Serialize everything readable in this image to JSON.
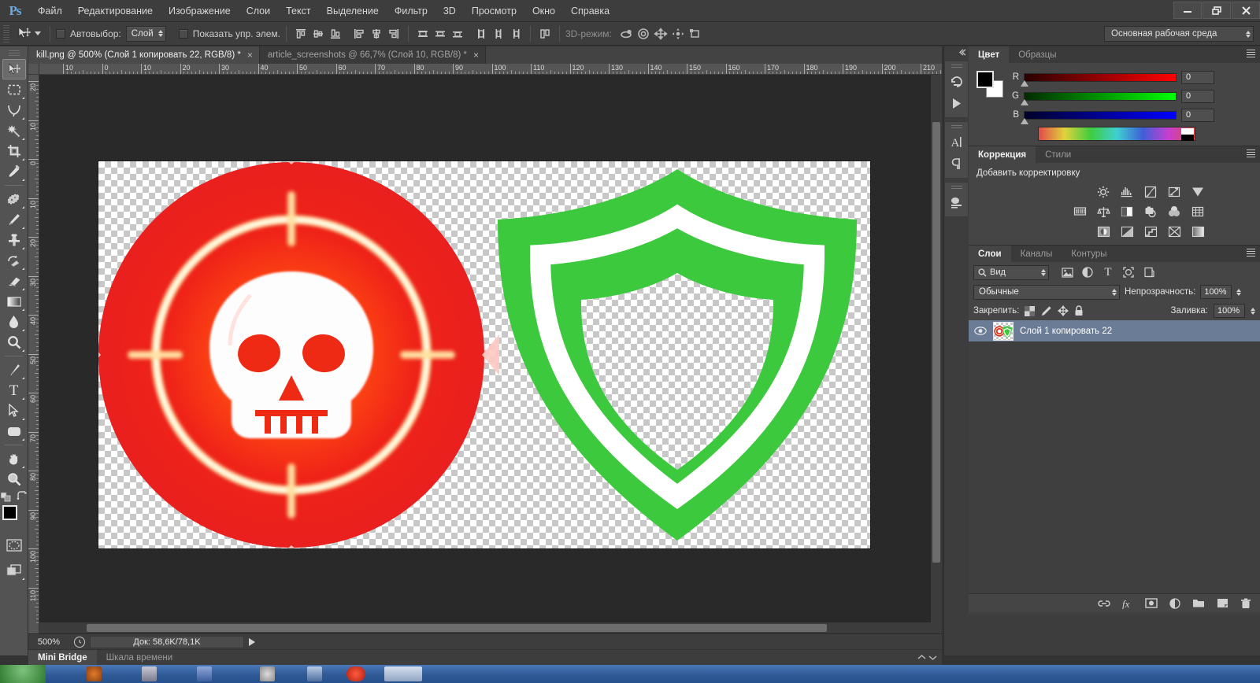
{
  "app": {
    "logo": "Ps",
    "menu": [
      "Файл",
      "Редактирование",
      "Изображение",
      "Слои",
      "Текст",
      "Выделение",
      "Фильтр",
      "3D",
      "Просмотр",
      "Окно",
      "Справка"
    ],
    "window_controls": {
      "minimize": "minimize-icon",
      "restore": "restore-icon",
      "close": "close-icon"
    }
  },
  "options_bar": {
    "tool_icon": "move-tool-icon",
    "autoselect_label": "Автовыбор:",
    "autoselect_checked": false,
    "autoselect_scope": "Слой",
    "show_controls_label": "Показать упр. элем.",
    "show_controls_checked": false,
    "align_icons": [
      "align-top-edges-icon",
      "align-vertical-centers-icon",
      "align-bottom-edges-icon",
      "align-left-edges-icon",
      "align-horizontal-centers-icon",
      "align-right-edges-icon"
    ],
    "distribute_icons": [
      "distribute-top-edges-icon",
      "distribute-vertical-centers-icon",
      "distribute-bottom-edges-icon",
      "distribute-left-edges-icon",
      "distribute-horizontal-centers-icon",
      "distribute-right-edges-icon"
    ],
    "auto_align_icon": "auto-align-layers-icon",
    "mode3d_label": "3D-режим:",
    "mode3d_icons": [
      "rotate-3d-object-icon",
      "roll-3d-object-icon",
      "drag-3d-object-icon",
      "slide-3d-object-icon",
      "scale-3d-object-icon"
    ],
    "workspace": "Основная рабочая среда"
  },
  "tabs": [
    {
      "title": "kill.png @ 500% (Слой 1 копировать 22, RGB/8) *",
      "active": true,
      "close": "×"
    },
    {
      "title": "article_screenshots @ 66,7% (Слой 10, RGB/8) *",
      "active": false,
      "close": "×"
    }
  ],
  "toolbar": {
    "tools": [
      {
        "name": "move-tool",
        "selected": true,
        "submenu": false
      },
      {
        "name": "rectangular-marquee-tool",
        "selected": false,
        "submenu": true
      },
      {
        "name": "lasso-tool",
        "selected": false,
        "submenu": true
      },
      {
        "name": "magic-wand-tool",
        "selected": false,
        "submenu": true
      },
      {
        "name": "crop-tool",
        "selected": false,
        "submenu": true
      },
      {
        "name": "eyedropper-tool",
        "selected": false,
        "submenu": true
      },
      {
        "name": "spot-healing-brush-tool",
        "selected": false,
        "submenu": true
      },
      {
        "name": "brush-tool",
        "selected": false,
        "submenu": true
      },
      {
        "name": "clone-stamp-tool",
        "selected": false,
        "submenu": true
      },
      {
        "name": "history-brush-tool",
        "selected": false,
        "submenu": true
      },
      {
        "name": "eraser-tool",
        "selected": false,
        "submenu": true
      },
      {
        "name": "gradient-tool",
        "selected": false,
        "submenu": true
      },
      {
        "name": "blur-tool",
        "selected": false,
        "submenu": true
      },
      {
        "name": "dodge-tool",
        "selected": false,
        "submenu": true
      },
      {
        "name": "pen-tool",
        "selected": false,
        "submenu": true
      },
      {
        "name": "horizontal-type-tool",
        "selected": false,
        "submenu": true
      },
      {
        "name": "path-selection-tool",
        "selected": false,
        "submenu": true
      },
      {
        "name": "rounded-rectangle-tool",
        "selected": false,
        "submenu": true
      },
      {
        "name": "hand-tool",
        "selected": false,
        "submenu": true
      },
      {
        "name": "zoom-tool",
        "selected": false,
        "submenu": true
      }
    ],
    "swap_colors_icon": "swap-foreground-background-icon",
    "default_colors_icon": "default-colors-icon",
    "foreground_color": "#000000",
    "background_color": "#ffffff",
    "quick_mask_icon": "quick-mask-mode-icon",
    "screen_mode_icon": "screen-mode-icon"
  },
  "rulers": {
    "unit_hint": "mm",
    "horizontal_labels": [
      "10",
      "0",
      "10",
      "20",
      "30",
      "40",
      "50",
      "60",
      "70",
      "80",
      "90",
      "100",
      "110",
      "120",
      "130",
      "140",
      "150",
      "160",
      "170",
      "180",
      "190",
      "200",
      "210"
    ],
    "vertical_labels": [
      "20",
      "10",
      "0",
      "10",
      "20",
      "30",
      "40",
      "50",
      "60",
      "70",
      "80",
      "90",
      "100",
      "110"
    ]
  },
  "canvas": {
    "document": "kill.png",
    "zoom": "500%",
    "artboard_width": 980,
    "artboard_height": 492,
    "artwork": [
      {
        "name": "kill-target-skull-badge",
        "colors": {
          "disc": "#e81f1f",
          "glow": "#ff5c14",
          "ring": "#fff3c4",
          "skull": "#fdfdfd"
        }
      },
      {
        "name": "protection-shield-badge",
        "colors": {
          "shield": "#3dc93d",
          "inner_stroke": "#ffffff"
        }
      }
    ]
  },
  "status_bar": {
    "zoom": "500%",
    "history_icon": "history-clock-icon",
    "doc_size": "Док: 58,6K/78,1K",
    "expand_icon": "expand-arrow-icon"
  },
  "bottom_tabs": [
    {
      "label": "Mini Bridge",
      "active": true
    },
    {
      "label": "Шкала времени",
      "active": false
    }
  ],
  "dock_rail": {
    "buttons": [
      {
        "name": "history-panel-icon"
      },
      {
        "name": "actions-panel-icon"
      },
      {
        "name": "character-panel-icon"
      },
      {
        "name": "paragraph-panel-icon"
      },
      {
        "name": "3d-panel-icon"
      }
    ]
  },
  "color_panel": {
    "tabs": [
      {
        "label": "Цвет",
        "active": true
      },
      {
        "label": "Образцы",
        "active": false
      }
    ],
    "foreground": "#000000",
    "background": "#ffffff",
    "channels": [
      {
        "label": "R",
        "value": "0",
        "gradient_to": "#ff0000"
      },
      {
        "label": "G",
        "value": "0",
        "gradient_to": "#00ff00"
      },
      {
        "label": "B",
        "value": "0",
        "gradient_to": "#0000ff"
      }
    ],
    "menu_icon": "panel-menu-icon"
  },
  "adjustments_panel": {
    "tabs": [
      {
        "label": "Коррекция",
        "active": true
      },
      {
        "label": "Стили",
        "active": false
      }
    ],
    "title": "Добавить корректировку",
    "rows": [
      [
        "brightness-contrast-icon",
        "levels-icon",
        "curves-icon",
        "exposure-icon",
        "vibrance-icon"
      ],
      [
        "hue-saturation-icon",
        "color-balance-icon",
        "black-white-icon",
        "photo-filter-icon",
        "channel-mixer-icon",
        "color-lookup-icon"
      ],
      [
        "invert-icon",
        "posterize-icon",
        "threshold-icon",
        "selective-color-icon",
        "gradient-map-icon"
      ]
    ],
    "menu_icon": "panel-menu-icon"
  },
  "layers_panel": {
    "tabs": [
      {
        "label": "Слои",
        "active": true
      },
      {
        "label": "Каналы",
        "active": false
      },
      {
        "label": "Контуры",
        "active": false
      }
    ],
    "filter": {
      "icon": "search-icon",
      "value": "Вид"
    },
    "filter_type_icons": [
      "filter-pixel-icon",
      "filter-adjustment-icon",
      "filter-type-icon",
      "filter-shape-icon",
      "filter-smartobject-icon"
    ],
    "blend_mode": "Обычные",
    "opacity_label": "Непрозрачность:",
    "opacity_value": "100%",
    "lock_label": "Закрепить:",
    "lock_icons": [
      "lock-transparent-pixels-icon",
      "lock-image-pixels-icon",
      "lock-position-icon",
      "lock-all-icon"
    ],
    "fill_label": "Заливка:",
    "fill_value": "100%",
    "layers": [
      {
        "name": "Слой 1 копировать 22",
        "visible": true,
        "selected": true,
        "thumbnail": "kill-and-shield-thumbnail"
      }
    ],
    "bottom_buttons": [
      "link-layers-icon",
      "layer-style-fx-icon",
      "add-layer-mask-icon",
      "new-adjustment-layer-icon",
      "new-group-icon",
      "new-layer-icon",
      "delete-layer-icon"
    ],
    "menu_icon": "panel-menu-icon"
  }
}
